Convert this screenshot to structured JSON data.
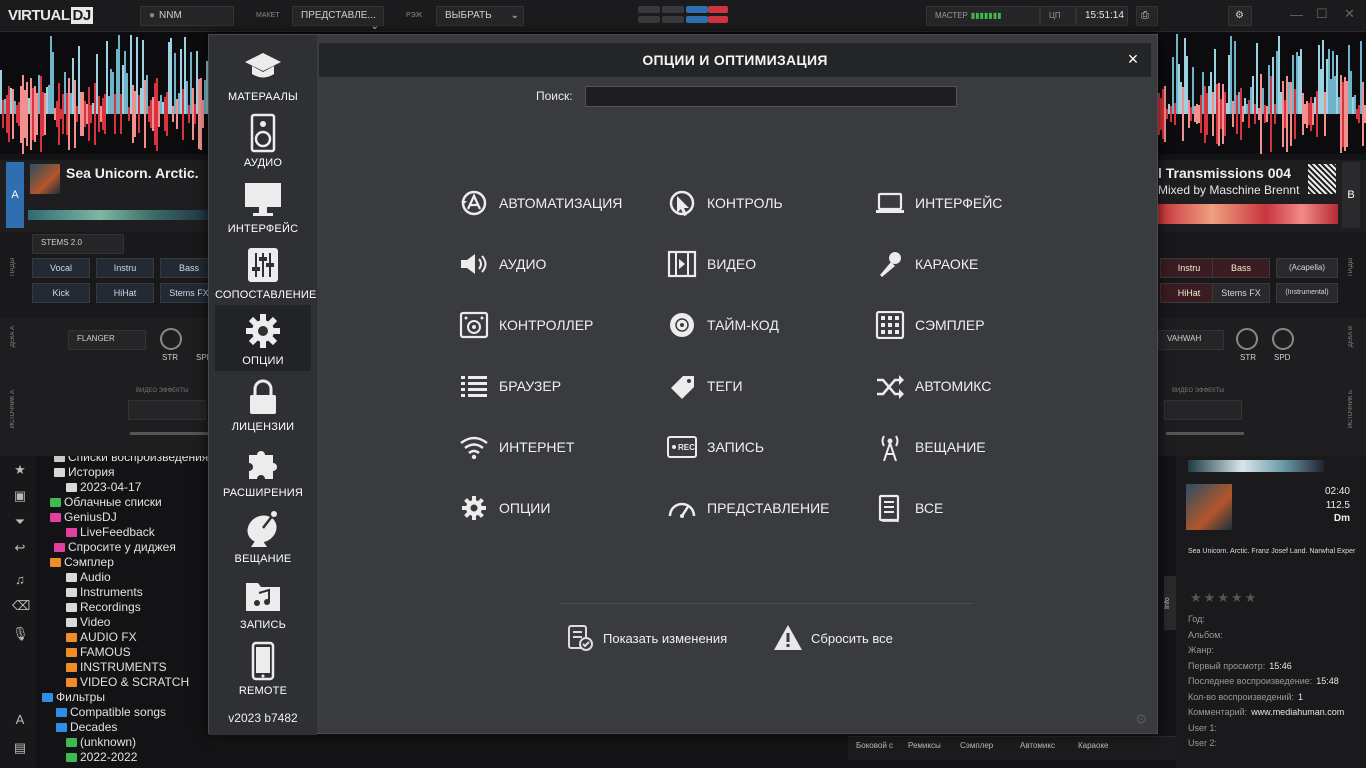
{
  "app": {
    "logo_main": "VIRTUAL",
    "logo_tag": "DJ",
    "user": "NNM",
    "layout_label": "МАКЕТ",
    "layout_value": "ПРЕДСТАВЛЕ...",
    "mode_label": "РЭЖ",
    "mode_value": "ВЫБРАТЬ",
    "master_label": "МАСТЕР",
    "cpu_label": "ЦП",
    "clock": "15:51:14"
  },
  "deck_a": {
    "letter": "A",
    "title": "Sea Unicorn. Arctic.",
    "stems_select": "STEMS 2.0",
    "pads": [
      "Vocal",
      "Instru",
      "Bass",
      "Kick",
      "HiHat",
      "Stems FX"
    ],
    "effect": "FLANGER",
    "knob1": "STR",
    "knob2": "SPD",
    "video_effects": "ВИДЕО ЭФФЕКТЫ",
    "side_label": "ПАДЫ",
    "side_label2": "ДЕКА А",
    "side_label3": "ИСТОЧНИК А"
  },
  "deck_b": {
    "letter": "B",
    "title": "l Transmissions 004",
    "subtitle": "Mixed by Maschine Brennt",
    "pads": [
      "Instru",
      "Bass",
      "(Acapella)",
      "HiHat",
      "Stems FX",
      "(Instrumental)"
    ],
    "effect": "VAHWAH",
    "knob1": "STR",
    "knob2": "SPD",
    "video_effects": "ВИДЕО ЭФФЕКТЫ",
    "side_label": "ПАДЫ",
    "side_label2": "ДЕКА В",
    "side_label3": "ИСТОЧНИК Б"
  },
  "tree": [
    {
      "label": "Списки воспроизведения",
      "color": "#c9c9c9"
    },
    {
      "label": "История",
      "color": "#d9d9d9"
    },
    {
      "label": "2023-04-17",
      "color": "#d9d9d9"
    },
    {
      "label": "Облачные списки",
      "color": "#3fb950"
    },
    {
      "label": "GeniusDJ",
      "color": "#e23fa0"
    },
    {
      "label": "LiveFeedback",
      "color": "#e23fa0"
    },
    {
      "label": "Спросите у диджея",
      "color": "#e23fa0"
    },
    {
      "label": "Сэмплер",
      "color": "#f08c2a"
    },
    {
      "label": "Audio",
      "color": "#d9d9d9"
    },
    {
      "label": "Instruments",
      "color": "#d9d9d9"
    },
    {
      "label": "Recordings",
      "color": "#d9d9d9"
    },
    {
      "label": "Video",
      "color": "#d9d9d9"
    },
    {
      "label": "AUDIO FX",
      "color": "#f08c2a"
    },
    {
      "label": "FAMOUS",
      "color": "#f08c2a"
    },
    {
      "label": "INSTRUMENTS",
      "color": "#f08c2a"
    },
    {
      "label": "VIDEO & SCRATCH",
      "color": "#f08c2a"
    },
    {
      "label": "Фильтры",
      "color": "#2f8ee6"
    },
    {
      "label": "Compatible songs",
      "color": "#2f8ee6"
    },
    {
      "label": "Decades",
      "color": "#2f8ee6"
    },
    {
      "label": "(unknown)",
      "color": "#3fb950"
    },
    {
      "label": "2022-2022",
      "color": "#3fb950"
    }
  ],
  "info": {
    "time": "02:40",
    "bpm": "112.5",
    "key": "Dm",
    "track": "Sea Unicorn. Arctic. Franz Josef Land. Narwhal Exper",
    "tab": "Info",
    "fields": [
      {
        "label": "Год:",
        "value": ""
      },
      {
        "label": "Альбом:",
        "value": ""
      },
      {
        "label": "Жанр:",
        "value": ""
      },
      {
        "label": "Первый просмотр:",
        "value": "15:46"
      },
      {
        "label": "Последнее воспроизведение:",
        "value": "15:48"
      },
      {
        "label": "Кол-во воспроизведений:",
        "value": "1"
      },
      {
        "label": "Комментарий:",
        "value": "www.mediahuman.com"
      },
      {
        "label": "User 1:",
        "value": ""
      },
      {
        "label": "User 2:",
        "value": ""
      }
    ]
  },
  "bottom_tabs": [
    "Боковой с",
    "Ремиксы",
    "Сэмплер",
    "Автомикс",
    "Караоке"
  ],
  "modal": {
    "title": "ОПЦИИ И ОПТИМИЗАЦИЯ",
    "close": "×",
    "search_label": "Поиск:",
    "search_value": "",
    "version": "v2023 b7482",
    "nav": [
      {
        "label": "МАТЕРААЛЫ",
        "icon": "graduation-cap-icon"
      },
      {
        "label": "АУДИО",
        "icon": "speaker-icon"
      },
      {
        "label": "ИНТЕРФЕЙС",
        "icon": "monitor-icon"
      },
      {
        "label": "СОПОСТАВЛЕНИЕ",
        "icon": "sliders-icon"
      },
      {
        "label": "ОПЦИИ",
        "icon": "gear-icon"
      },
      {
        "label": "ЛИЦЕНЗИИ",
        "icon": "lock-icon"
      },
      {
        "label": "РАСШИРЕНИЯ",
        "icon": "puzzle-icon"
      },
      {
        "label": "ВЕЩАНИЕ",
        "icon": "satellite-dish-icon"
      },
      {
        "label": "ЗАПИСЬ",
        "icon": "music-folder-icon"
      },
      {
        "label": "REMOTE",
        "icon": "phone-icon"
      }
    ],
    "active_nav": "ОПЦИИ",
    "options": [
      {
        "label": "АВТОМАТИЗАЦИЯ",
        "icon": "automation-icon"
      },
      {
        "label": "КОНТРОЛЬ",
        "icon": "cursor-icon"
      },
      {
        "label": "ИНТЕРФЕЙС",
        "icon": "laptop-icon"
      },
      {
        "label": "АУДИО",
        "icon": "volume-icon"
      },
      {
        "label": "ВИДЕО",
        "icon": "film-icon"
      },
      {
        "label": "КАРАОКЕ",
        "icon": "microphone-icon"
      },
      {
        "label": "КОНТРОЛЛЕР",
        "icon": "controller-icon"
      },
      {
        "label": "ТАЙМ-КОД",
        "icon": "vinyl-icon"
      },
      {
        "label": "СЭМПЛЕР",
        "icon": "grid-icon"
      },
      {
        "label": "БРАУЗЕР",
        "icon": "list-icon"
      },
      {
        "label": "ТЕГИ",
        "icon": "tag-icon"
      },
      {
        "label": "АВТОМИКС",
        "icon": "shuffle-icon"
      },
      {
        "label": "ИНТЕРНЕТ",
        "icon": "wifi-icon"
      },
      {
        "label": "ЗАПИСЬ",
        "icon": "rec-icon"
      },
      {
        "label": "ВЕЩАНИЕ",
        "icon": "broadcast-tower-icon"
      },
      {
        "label": "ОПЦИИ",
        "icon": "gear-icon"
      },
      {
        "label": "ПРЕДСТАВЛЕНИЕ",
        "icon": "gauge-icon"
      },
      {
        "label": "ВСЕ",
        "icon": "document-icon"
      }
    ],
    "footer": {
      "show_changes": "Показать изменения",
      "reset_all": "Сбросить все"
    }
  },
  "colors": {
    "accent_blue": "#2f6fb0",
    "accent_red": "#d0343f",
    "modal_bg": "#3a3b3e",
    "nav_bg": "#2f3033"
  }
}
